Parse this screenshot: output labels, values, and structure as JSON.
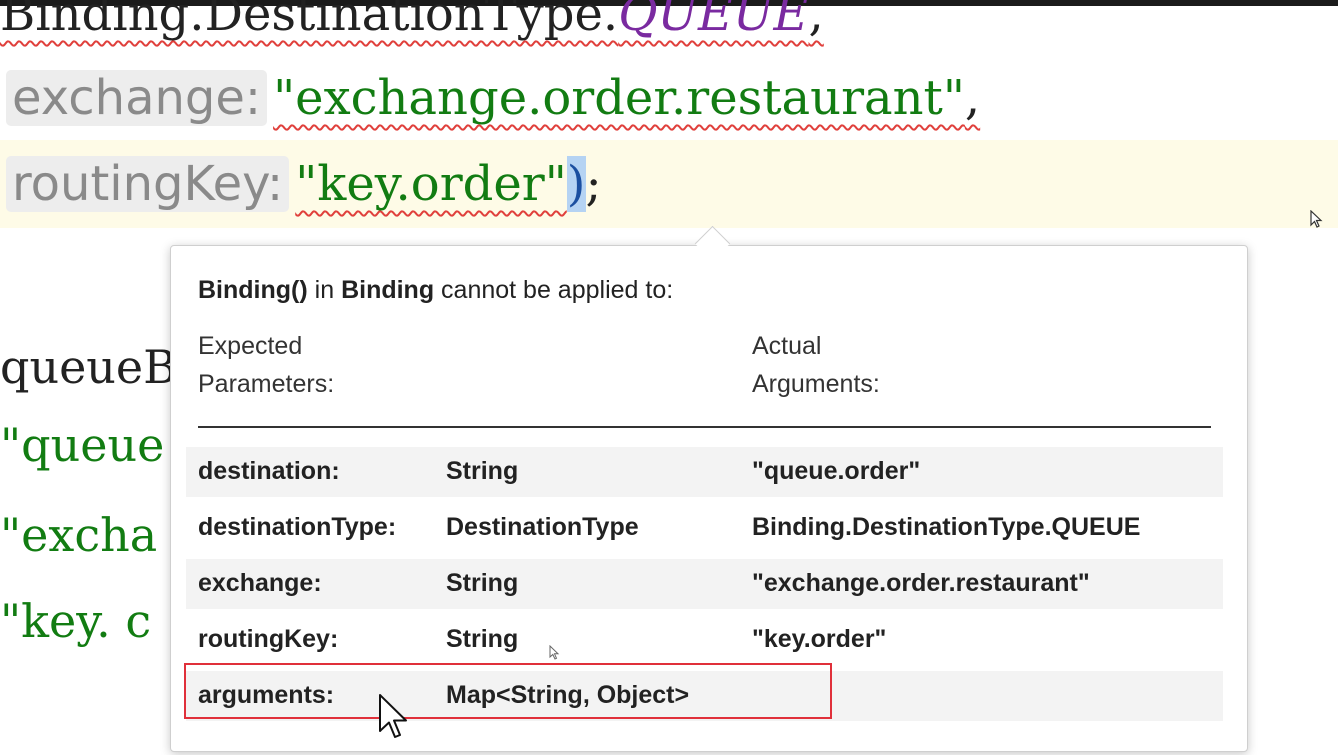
{
  "editor": {
    "line1": {
      "prefix": "Binding.DestinationType.",
      "constant": "QUEUE",
      "suffix": ","
    },
    "line2": {
      "hint": "exchange:",
      "value": "\"exchange.order.restaurant\"",
      "suffix": ","
    },
    "line3": {
      "hint": "routingKey:",
      "value": "\"key.order\"",
      "bracket": ")",
      "suffix": ";"
    },
    "behind": [
      "queueB",
      "\"queue",
      "\"excha",
      "\"key. c"
    ]
  },
  "tooltip": {
    "method": "Binding()",
    "in_word": "in",
    "class_name": "Binding",
    "message": "cannot be applied to:",
    "expected_header": "Expected",
    "expected_header2": "Parameters:",
    "actual_header": "Actual",
    "actual_header2": "Arguments:",
    "rows": [
      {
        "param": "destination:",
        "type": "String",
        "arg": "\"queue.order\""
      },
      {
        "param": "destinationType:",
        "type": "DestinationType",
        "arg": "Binding.DestinationType.QUEUE"
      },
      {
        "param": "exchange:",
        "type": "String",
        "arg": "\"exchange.order.restaurant\""
      },
      {
        "param": "routingKey:",
        "type": "String",
        "arg": "\"key.order\""
      },
      {
        "param": "arguments:",
        "type": "Map<String, Object>",
        "arg": ""
      }
    ]
  },
  "colors": {
    "string": "#127c12",
    "constant": "#7a2aa0",
    "error_underline": "#e0403c",
    "highlight_box": "#e0303a",
    "current_line": "#fefbe7"
  }
}
